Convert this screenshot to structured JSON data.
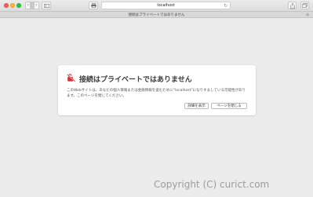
{
  "browser": {
    "address": "localhost",
    "tab_title": "接続はプライベートではありません",
    "back_icon": "‹",
    "forward_icon": "›",
    "reload_icon": "↻",
    "new_tab_icon": "+"
  },
  "warning": {
    "title": "接続はプライベートではありません",
    "message": "このWebサイトは、あなたの個人情報または金融情報を盗むために“localhost”になりすましている可能性があります。このページを閉じてください。",
    "details_button": "詳細を表示",
    "close_button": "ページを閉じる",
    "icon_color": "#d0303a"
  },
  "watermark": "Copyright (C) curict.com"
}
